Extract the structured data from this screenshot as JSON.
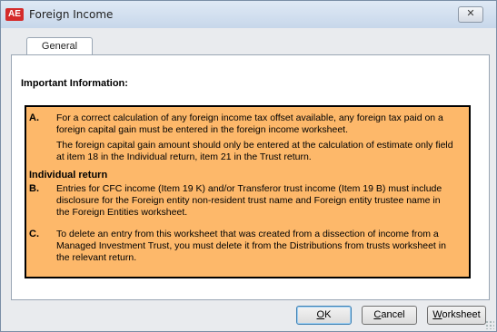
{
  "window": {
    "title": "Foreign Income",
    "app_badge": "AE",
    "close_label": "✕"
  },
  "tabs": [
    {
      "label": "General"
    }
  ],
  "panel": {
    "heading": "Important Information:",
    "items": [
      {
        "letter": "A.",
        "text": "For a correct calculation of any foreign income tax offset available, any foreign tax paid on a foreign capital gain must be entered in the foreign income worksheet."
      },
      {
        "letter": "",
        "text": "The foreign capital gain amount should only be entered at the calculation of estimate only field at item 18 in the Individual return, item 21 in the Trust return."
      },
      {
        "subhead": "Individual return"
      },
      {
        "letter": "B.",
        "text": "Entries for CFC income (Item 19 K) and/or Transferor trust income (Item 19 B) must include disclosure for the Foreign entity non-resident trust name and Foreign entity trustee name in the Foreign Entities worksheet."
      },
      {
        "letter": "C.",
        "text": "To delete an entry from this worksheet that was created from a dissection of income from a Managed Investment Trust, you must delete it from the Distributions from trusts worksheet in the relevant return."
      }
    ]
  },
  "buttons": {
    "ok": {
      "mnemonic": "O",
      "rest": "K"
    },
    "cancel": {
      "mnemonic": "C",
      "rest": "ancel"
    },
    "worksheet": {
      "mnemonic": "W",
      "rest": "orksheet"
    }
  }
}
